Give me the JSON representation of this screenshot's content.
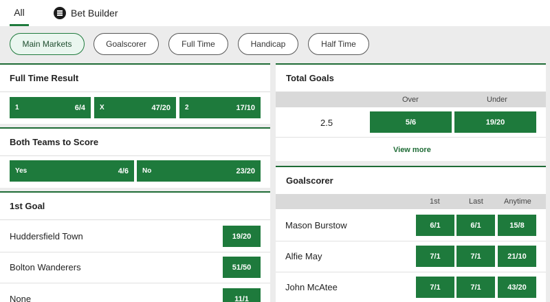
{
  "tabs": {
    "all": "All",
    "bet_builder": "Bet Builder"
  },
  "filters": [
    {
      "label": "Main Markets",
      "active": true
    },
    {
      "label": "Goalscorer"
    },
    {
      "label": "Full Time"
    },
    {
      "label": "Handicap"
    },
    {
      "label": "Half Time"
    }
  ],
  "full_time_result": {
    "title": "Full Time Result",
    "options": [
      {
        "label": "1",
        "odds": "6/4"
      },
      {
        "label": "X",
        "odds": "47/20"
      },
      {
        "label": "2",
        "odds": "17/10"
      }
    ]
  },
  "both_teams": {
    "title": "Both Teams to Score",
    "options": [
      {
        "label": "Yes",
        "odds": "4/6"
      },
      {
        "label": "No",
        "odds": "23/20"
      }
    ]
  },
  "first_goal": {
    "title": "1st Goal",
    "rows": [
      {
        "team": "Huddersfield Town",
        "odds": "19/20"
      },
      {
        "team": "Bolton Wanderers",
        "odds": "51/50"
      },
      {
        "team": "None",
        "odds": "11/1"
      }
    ]
  },
  "total_goals": {
    "title": "Total Goals",
    "over_label": "Over",
    "under_label": "Under",
    "line": "2.5",
    "over_odds": "5/6",
    "under_odds": "19/20",
    "view_more": "View more"
  },
  "goalscorer": {
    "title": "Goalscorer",
    "col_first": "1st",
    "col_last": "Last",
    "col_anytime": "Anytime",
    "rows": [
      {
        "player": "Mason Burstow",
        "first": "6/1",
        "last": "6/1",
        "anytime": "15/8"
      },
      {
        "player": "Alfie May",
        "first": "7/1",
        "last": "7/1",
        "anytime": "21/10"
      },
      {
        "player": "John McAtee",
        "first": "7/1",
        "last": "7/1",
        "anytime": "43/20"
      }
    ]
  },
  "colors": {
    "accent": "#1e7a3c",
    "panel_border": "#1e6b35",
    "grey_bg": "#ececec"
  }
}
